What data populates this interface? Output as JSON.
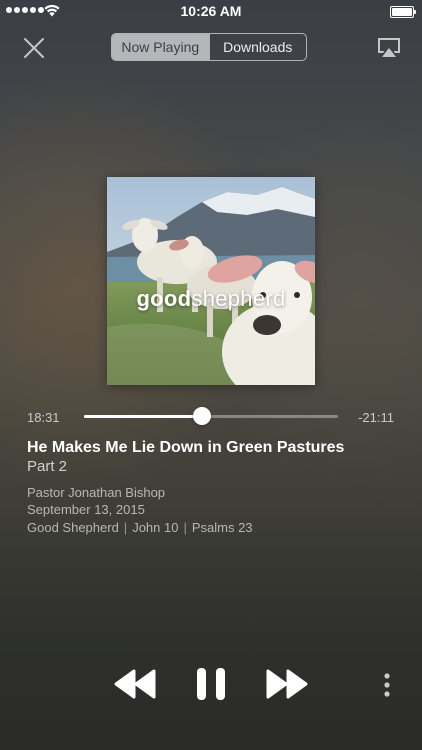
{
  "status_bar": {
    "time": "10:26 AM",
    "signal_icon": "signal-dots-icon",
    "wifi_icon": "wifi-icon",
    "battery_icon": "battery-icon"
  },
  "header": {
    "close_icon": "close-icon",
    "tabs": [
      {
        "label": "Now Playing",
        "active": true
      },
      {
        "label": "Downloads",
        "active": false
      }
    ],
    "airplay_icon": "airplay-icon"
  },
  "artwork": {
    "brand_bold": "good",
    "brand_light": "shepherd"
  },
  "progress": {
    "elapsed": "18:31",
    "remaining": "-21:11",
    "fraction": 0.466
  },
  "episode": {
    "title": "He Makes Me Lie Down in Green Pastures",
    "subtitle": "Part 2",
    "speaker": "Pastor Jonathan Bishop",
    "date": "September 13, 2015",
    "series": "Good Shepherd",
    "scripture_1": "John 10",
    "scripture_2": "Psalms 23",
    "separator": "|"
  },
  "controls": {
    "rewind_icon": "rewind-icon",
    "pause_icon": "pause-icon",
    "forward_icon": "fast-forward-icon",
    "more_icon": "more-vertical-icon"
  },
  "colors": {
    "text_primary": "#ffffff",
    "segment_active_bg": "#dcdee1",
    "segment_active_text": "#3e4146"
  }
}
